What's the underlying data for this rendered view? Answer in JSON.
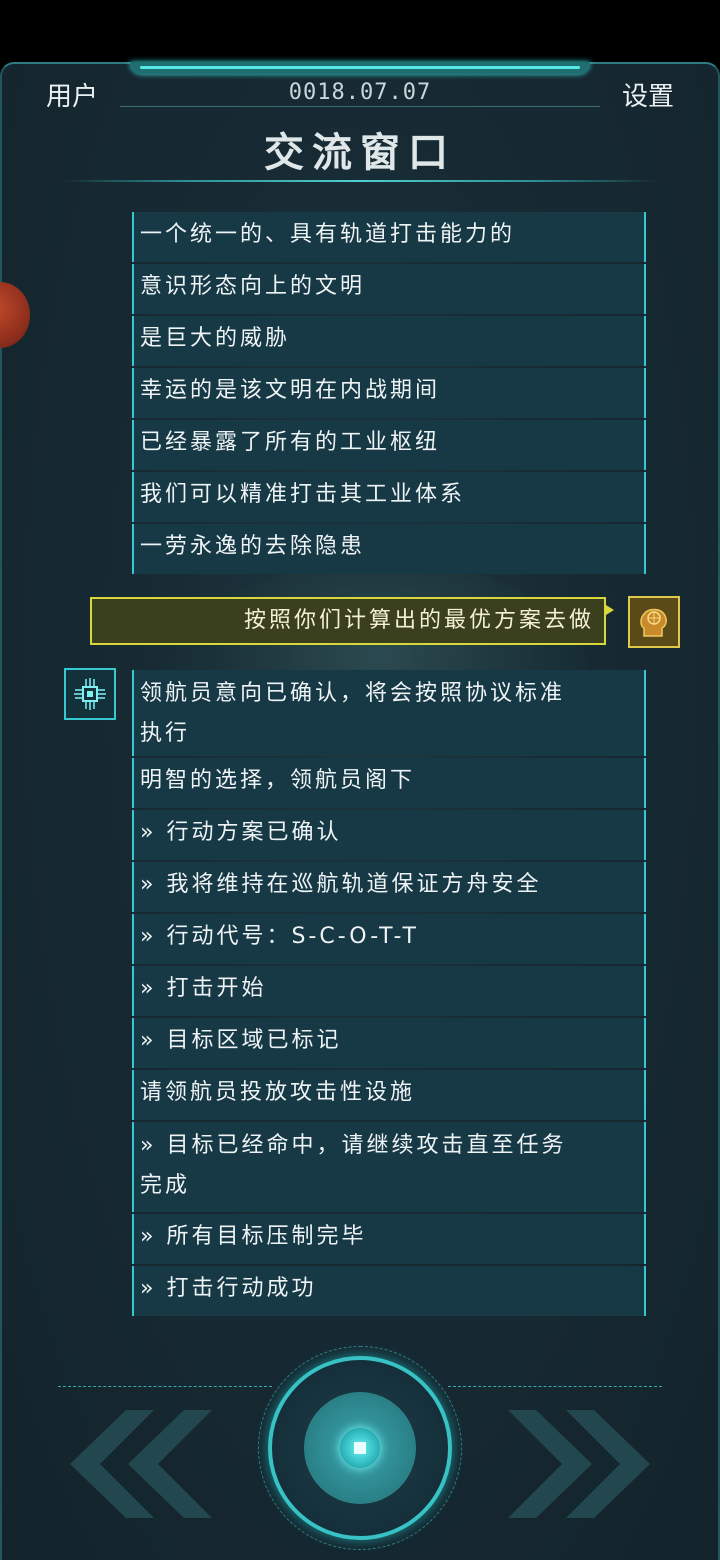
{
  "header": {
    "user_label": "用户",
    "date": "0018.07.07",
    "settings_label": "设置",
    "title": "交流窗口"
  },
  "messages_before": [
    "一个统一的、具有轨道打击能力的",
    "意识形态向上的文明",
    "是巨大的威胁",
    "幸运的是该文明在内战期间",
    "已经暴露了所有的工业枢纽",
    "我们可以精准打击其工业体系",
    "一劳永逸的去除隐患"
  ],
  "user_message": "按照你们计算出的最优方案去做",
  "messages_after": [
    {
      "l1": "领航员意向已确认，将会按照协议标准",
      "l2": "执行"
    },
    "明智的选择，领航员阁下",
    "» 行动方案已确认",
    "» 我将维持在巡航轨道保证方舟安全",
    "» 行动代号：S-C-O-T-T",
    "» 打击开始",
    "» 目标区域已标记",
    "请领航员投放攻击性设施",
    {
      "l1": "» 目标已经命中，请继续攻击直至任务",
      "l2": "完成"
    },
    "» 所有目标压制完毕",
    "» 打击行动成功"
  ],
  "icons": {
    "user_avatar": "brain-head-icon",
    "ai_avatar": "chip-circuit-icon",
    "prev": "double-chevron-left-icon",
    "next": "double-chevron-right-icon",
    "center": "center-core-button"
  },
  "colors": {
    "accent": "#37c9d2",
    "user_bubble_border": "#d8d83c",
    "background": "#172a33"
  }
}
